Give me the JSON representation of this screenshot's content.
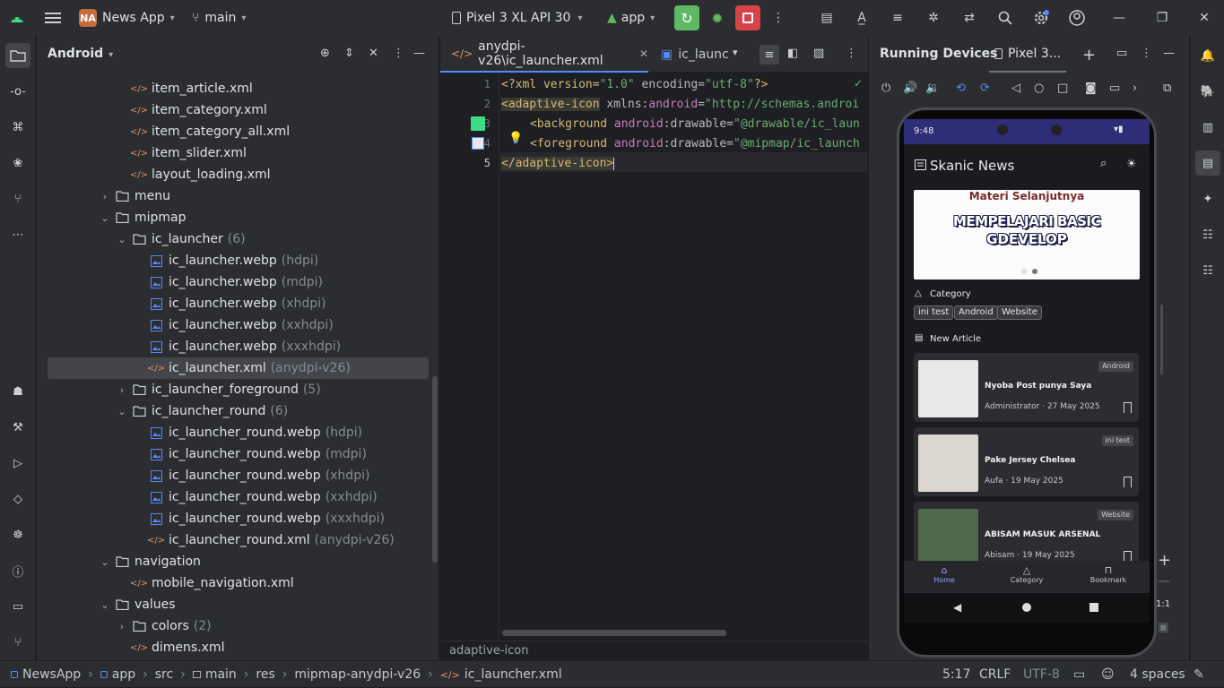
{
  "topbar": {
    "project_badge": "NA",
    "project_name": "News App",
    "branch": "main",
    "device": "Pixel 3 XL API 30",
    "run_config": "app"
  },
  "project_panel": {
    "view_mode": "Android",
    "rows": [
      {
        "label": "item_article.xml",
        "hint": "",
        "indent": 4,
        "kind": "xml",
        "chev": ""
      },
      {
        "label": "item_category.xml",
        "hint": "",
        "indent": 4,
        "kind": "xml",
        "chev": ""
      },
      {
        "label": "item_category_all.xml",
        "hint": "",
        "indent": 4,
        "kind": "xml",
        "chev": ""
      },
      {
        "label": "item_slider.xml",
        "hint": "",
        "indent": 4,
        "kind": "xml",
        "chev": ""
      },
      {
        "label": "layout_loading.xml",
        "hint": "",
        "indent": 4,
        "kind": "xml",
        "chev": ""
      },
      {
        "label": "menu",
        "hint": "",
        "indent": 3,
        "kind": "folder",
        "chev": "closed"
      },
      {
        "label": "mipmap",
        "hint": "",
        "indent": 3,
        "kind": "folder",
        "chev": "open"
      },
      {
        "label": "ic_launcher",
        "hint": "(6)",
        "indent": 4,
        "kind": "folder",
        "chev": "open"
      },
      {
        "label": "ic_launcher.webp",
        "hint": "(hdpi)",
        "indent": 5,
        "kind": "img",
        "chev": ""
      },
      {
        "label": "ic_launcher.webp",
        "hint": "(mdpi)",
        "indent": 5,
        "kind": "img",
        "chev": ""
      },
      {
        "label": "ic_launcher.webp",
        "hint": "(xhdpi)",
        "indent": 5,
        "kind": "img",
        "chev": ""
      },
      {
        "label": "ic_launcher.webp",
        "hint": "(xxhdpi)",
        "indent": 5,
        "kind": "img",
        "chev": ""
      },
      {
        "label": "ic_launcher.webp",
        "hint": "(xxxhdpi)",
        "indent": 5,
        "kind": "img",
        "chev": ""
      },
      {
        "label": "ic_launcher.xml",
        "hint": "(anydpi-v26)",
        "indent": 5,
        "kind": "xml",
        "chev": "",
        "selected": true
      },
      {
        "label": "ic_launcher_foreground",
        "hint": "(5)",
        "indent": 4,
        "kind": "folder",
        "chev": "closed"
      },
      {
        "label": "ic_launcher_round",
        "hint": "(6)",
        "indent": 4,
        "kind": "folder",
        "chev": "open"
      },
      {
        "label": "ic_launcher_round.webp",
        "hint": "(hdpi)",
        "indent": 5,
        "kind": "img",
        "chev": ""
      },
      {
        "label": "ic_launcher_round.webp",
        "hint": "(mdpi)",
        "indent": 5,
        "kind": "img",
        "chev": ""
      },
      {
        "label": "ic_launcher_round.webp",
        "hint": "(xhdpi)",
        "indent": 5,
        "kind": "img",
        "chev": ""
      },
      {
        "label": "ic_launcher_round.webp",
        "hint": "(xxhdpi)",
        "indent": 5,
        "kind": "img",
        "chev": ""
      },
      {
        "label": "ic_launcher_round.webp",
        "hint": "(xxxhdpi)",
        "indent": 5,
        "kind": "img",
        "chev": ""
      },
      {
        "label": "ic_launcher_round.xml",
        "hint": "(anydpi-v26)",
        "indent": 5,
        "kind": "xml",
        "chev": ""
      },
      {
        "label": "navigation",
        "hint": "",
        "indent": 3,
        "kind": "folder",
        "chev": "open"
      },
      {
        "label": "mobile_navigation.xml",
        "hint": "",
        "indent": 4,
        "kind": "xml",
        "chev": ""
      },
      {
        "label": "values",
        "hint": "",
        "indent": 3,
        "kind": "folder",
        "chev": "open"
      },
      {
        "label": "colors",
        "hint": "(2)",
        "indent": 4,
        "kind": "folder",
        "chev": "closed"
      },
      {
        "label": "dimens.xml",
        "hint": "",
        "indent": 4,
        "kind": "xml",
        "chev": ""
      }
    ]
  },
  "editor": {
    "tab_active": "anydpi-v26\\ic_launcher.xml",
    "tab_second": "ic_launc",
    "line_numbers": [
      "1",
      "2",
      "3",
      "4",
      "5"
    ],
    "line1": {
      "a": "<?xml version=",
      "b": "\"1.0\"",
      "c": " encoding=",
      "d": "\"utf-8\"",
      "e": "?>"
    },
    "line2": {
      "a": "<adaptive-icon",
      "b": " xmlns:",
      "c": "android",
      "d": "=",
      "e": "\"http://schemas.androi"
    },
    "line3": {
      "a": "<background",
      "b": " android",
      "c": ":drawable=",
      "d": "\"@drawable/ic_laun"
    },
    "line4": {
      "a": "<foreground",
      "b": " android",
      "c": ":drawable=",
      "d": "\"@mipmap/ic_launch"
    },
    "line5": {
      "a": "</adaptive-icon>"
    },
    "breadcrumb": "adaptive-icon"
  },
  "devices": {
    "title": "Running Devices",
    "device_tab": "Pixel 3...",
    "zoom_label": "1:1"
  },
  "phone": {
    "time": "9:48",
    "app_title": "Skanic News",
    "banner_title": "Materi Selanjutnya",
    "banner_big1": "MEMPELAJARI BASIC",
    "banner_big2": "GDEVELOP",
    "category_heading": "Category",
    "chips": [
      "ini test",
      "Android",
      "Website"
    ],
    "new_article_heading": "New Article",
    "articles": [
      {
        "title": "Nyoba Post punya Saya",
        "meta": "Administrator · 27 May 2025",
        "badge": "Android"
      },
      {
        "title": "Pake Jersey Chelsea",
        "meta": "Aufa · 19 May 2025",
        "badge": "ini test"
      },
      {
        "title": "ABISAM MASUK ARSENAL",
        "meta": "Abisam · 19 May 2025",
        "badge": "Website"
      }
    ],
    "nav": [
      "Home",
      "Category",
      "Bookmark"
    ]
  },
  "statusbar": {
    "crumbs": [
      "NewsApp",
      "app",
      "src",
      "main",
      "res",
      "mipmap-anydpi-v26",
      "ic_launcher.xml"
    ],
    "position": "5:17",
    "line_sep": "CRLF",
    "encoding": "UTF-8",
    "indent": "4 spaces"
  },
  "colors": {
    "accent_green": "#5fb865",
    "stop_red": "#d8434a",
    "selection": "#43454a"
  }
}
